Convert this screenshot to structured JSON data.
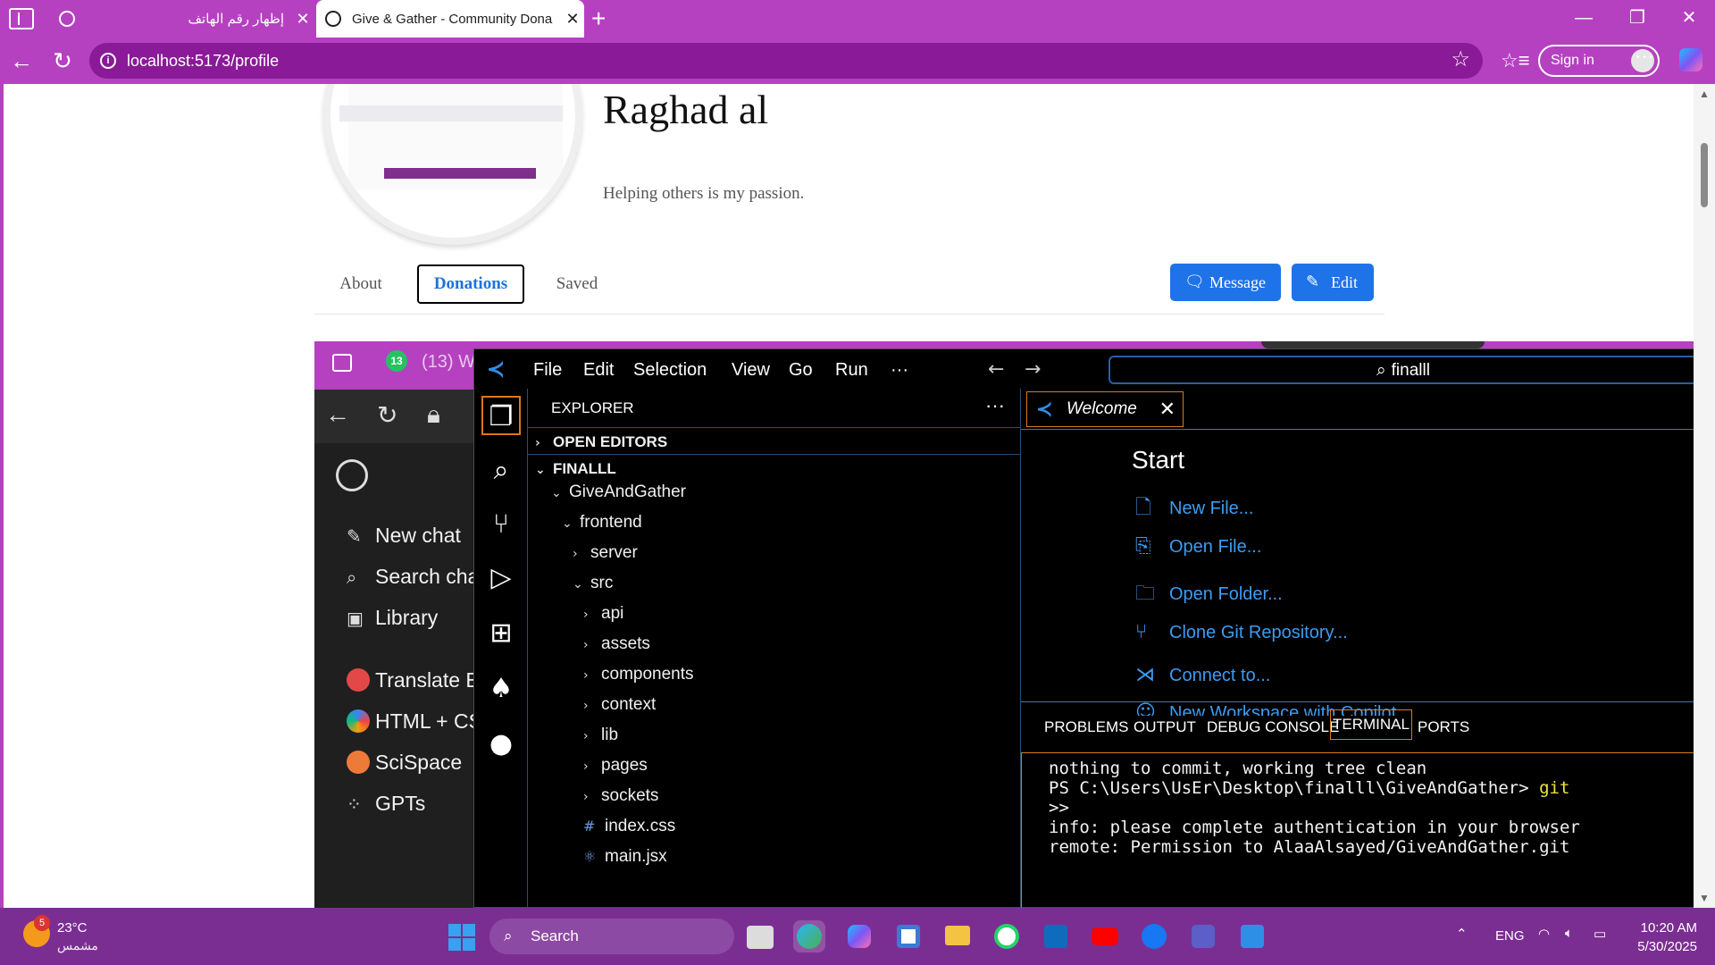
{
  "browser": {
    "tabs": [
      {
        "title": "إظهار رقم الهاتف",
        "active": false
      },
      {
        "title": "Give & Gather - Community Dona",
        "active": true
      }
    ],
    "url": "localhost:5173/profile",
    "signin_label": "Sign in",
    "accent": "#b541c0"
  },
  "profile": {
    "name": "Raghad al",
    "bio": "Helping others is my passion.",
    "tabs": [
      "About",
      "Donations",
      "Saved"
    ],
    "active_tab": "Donations",
    "message_label": "Message",
    "edit_label": "Edit"
  },
  "embedded": {
    "whatsapp_badge": "13",
    "window_title": "(13) W",
    "chatgpt_sidebar": [
      "New chat",
      "Search cha",
      "Library",
      "Translate E",
      "HTML + CS",
      "SciSpace",
      "GPTs"
    ],
    "vscode": {
      "menu": [
        "File",
        "Edit",
        "Selection",
        "View",
        "Go",
        "Run",
        "···"
      ],
      "search": "finalll",
      "explorer_label": "EXPLORER",
      "tree": [
        {
          "label": "OPEN EDITORS"
        },
        {
          "label": "FINALLL"
        },
        {
          "label": "GiveAndGather"
        },
        {
          "label": "frontend"
        },
        {
          "label": "server"
        },
        {
          "label": "src"
        },
        {
          "label": "api"
        },
        {
          "label": "assets"
        },
        {
          "label": "components"
        },
        {
          "label": "context"
        },
        {
          "label": "lib"
        },
        {
          "label": "pages"
        },
        {
          "label": "sockets"
        },
        {
          "label": "index.css"
        },
        {
          "label": "main.jsx"
        }
      ],
      "editor_tab": "Welcome",
      "start_heading": "Start",
      "start_links": [
        "New File...",
        "Open File...",
        "Open Folder...",
        "Clone Git Repository...",
        "Connect to...",
        "New Workspace with Copilot"
      ],
      "panel_tabs": [
        "PROBLEMS",
        "OUTPUT",
        "DEBUG CONSOLE",
        "TERMINAL",
        "PORTS"
      ],
      "active_panel": "TERMINAL",
      "terminal": {
        "line1": "nothing to commit, working tree clean",
        "line2_prompt": "PS C:\\Users\\UsEr\\Desktop\\finalll\\GiveAndGather> ",
        "line2_cmd": "git",
        "line3": ">>",
        "line4": "info: please complete authentication in your browser",
        "line5": "remote: Permission to AlaaAlsayed/GiveAndGather.git"
      }
    }
  },
  "taskbar": {
    "weather_badge": "5",
    "temperature": "23°C",
    "weather_desc": "مشمس",
    "search_label": "Search",
    "language": "ENG",
    "time": "10:20 AM",
    "date": "5/30/2025"
  }
}
